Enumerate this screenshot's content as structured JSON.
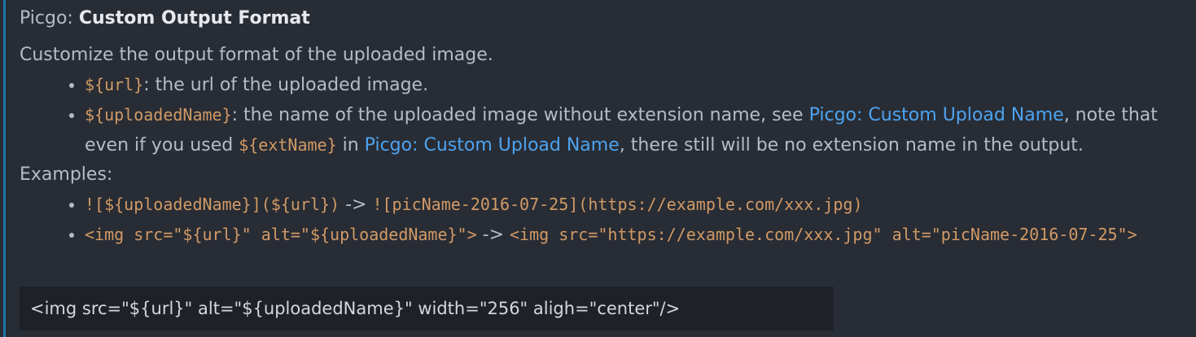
{
  "setting": {
    "category": "Picgo: ",
    "label": "Custom Output Format",
    "description_intro": "Customize the output format of the uploaded image.",
    "vars": [
      {
        "code": "${url}",
        "text": ": the url of the uploaded image."
      },
      {
        "code": "${uploadedName}",
        "text_a": ": the name of the uploaded image without extension name, see ",
        "link1": "Picgo: Custom Upload Name",
        "text_b": ", note that even if you used ",
        "code2": "${extName}",
        "text_c": " in ",
        "link2": "Picgo: Custom Upload Name",
        "text_d": ", there still will be no extension name in the output."
      }
    ],
    "examples_label": "Examples:",
    "examples": [
      {
        "from": "![${uploadedName}](${url})",
        "arrow": " -> ",
        "to": "![picName-2016-07-25](https://example.com/xxx.jpg)"
      },
      {
        "from": "<img src=\"${url}\" alt=\"${uploadedName}\">",
        "arrow": " -> ",
        "to": "<img src=\"https://example.com/xxx.jpg\" alt=\"picName-2016-07-25\">"
      }
    ],
    "input_value": "<img src=\"${url}\" alt=\"${uploadedName}\" width=\"256\" aligh=\"center\"/>"
  },
  "colors": {
    "background": "#282c34",
    "focus_bar": "#1c78a8",
    "code": "#d19a66",
    "link": "#4da3f0",
    "input_background": "#1e2128"
  }
}
